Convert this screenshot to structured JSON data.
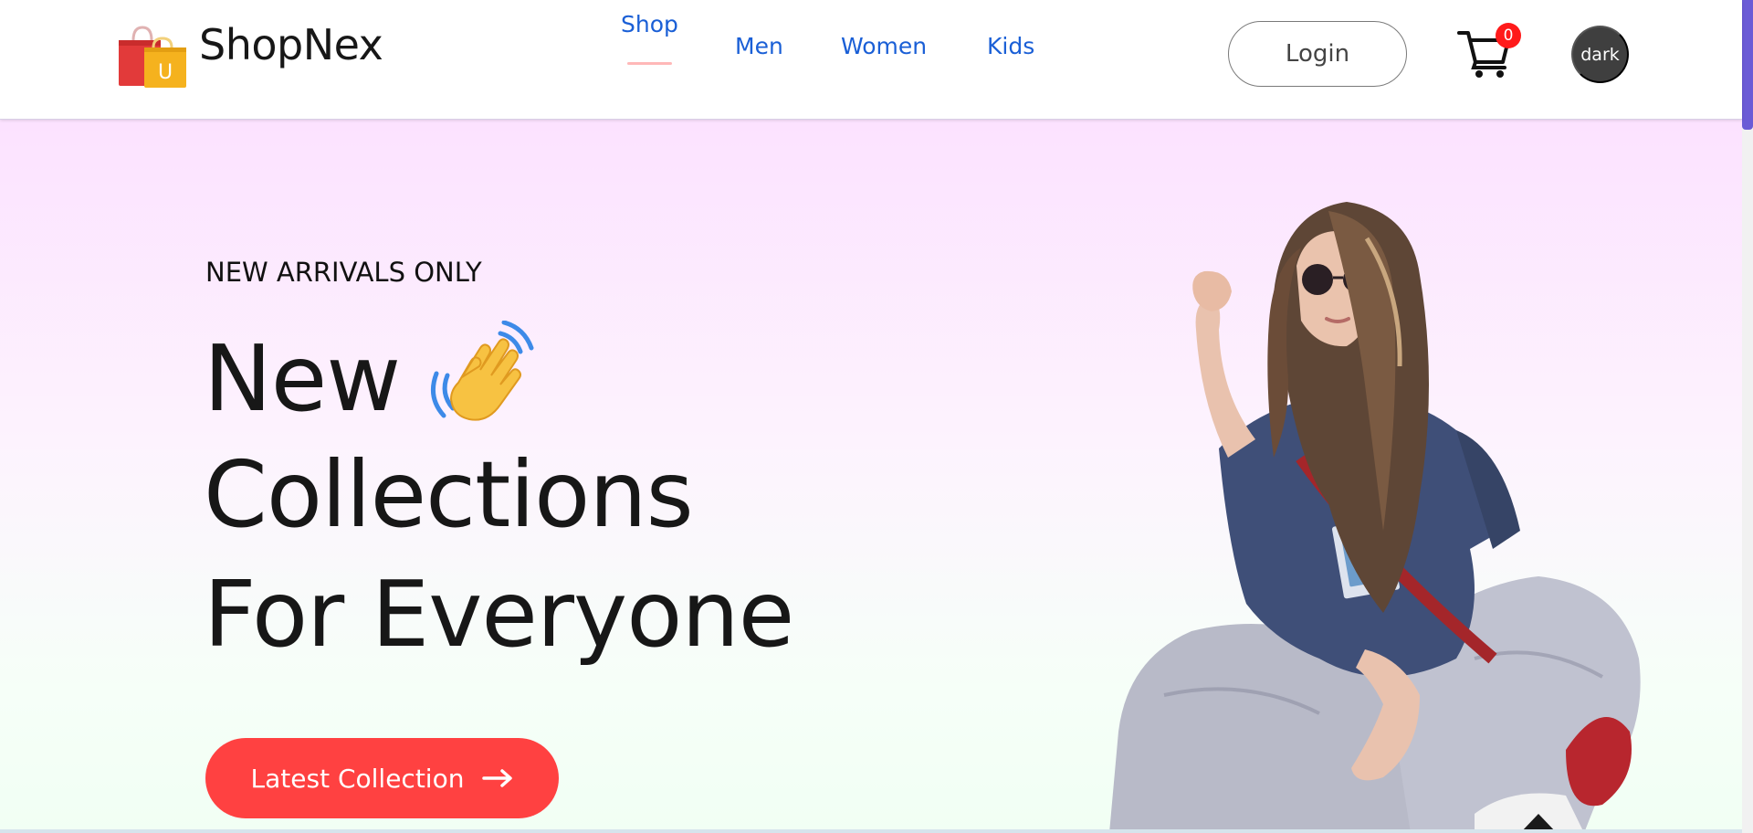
{
  "brand": {
    "name": "ShopNex",
    "logo_icon": "shopping-bags-icon",
    "logo_letter": "U"
  },
  "nav": {
    "items": [
      {
        "label": "Shop",
        "active": true
      },
      {
        "label": "Men",
        "active": false
      },
      {
        "label": "Women",
        "active": false
      },
      {
        "label": "Kids",
        "active": false
      }
    ]
  },
  "header": {
    "login_label": "Login",
    "cart_icon": "cart-icon",
    "cart_count": "0",
    "theme_label": "dark"
  },
  "hero": {
    "tagline": "NEW ARRIVALS ONLY",
    "line1": "New",
    "line2": "Collections",
    "line3": "For Everyone",
    "cta_label": "Latest Collection",
    "wave_icon": "waving-hand-icon",
    "arrow_icon": "arrow-right-icon",
    "image": "hero-model-image"
  },
  "colors": {
    "nav_link": "#1a5fd6",
    "accent": "#ff4141",
    "badge": "#ff1a1a",
    "active_underline": "#ffb8b8",
    "hero_top": "#fce2ff",
    "hero_bottom": "#f1fff4",
    "theme_toggle": "#3f3f3f"
  }
}
